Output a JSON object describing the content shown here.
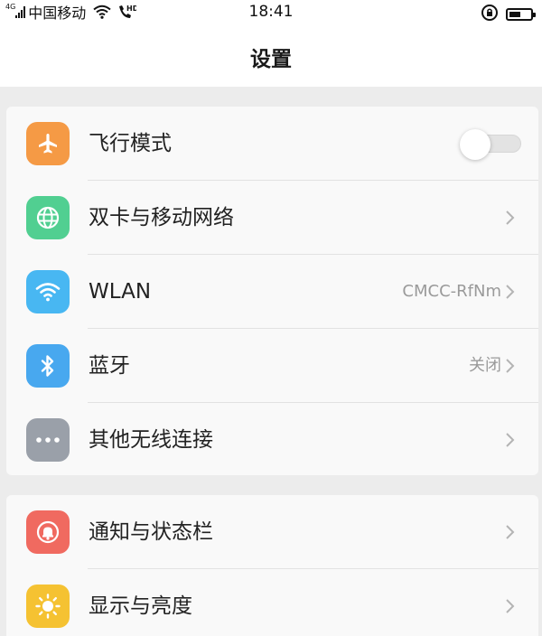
{
  "status_bar": {
    "network_type": "4G",
    "carrier": "中国移动",
    "time": "18:41",
    "battery_level": 0.55,
    "icons": [
      "signal-icon",
      "wifi-icon",
      "hd-call-icon",
      "rotation-lock-icon",
      "battery-icon"
    ]
  },
  "header": {
    "title": "设置"
  },
  "colors": {
    "airplane": "#f59a45",
    "network": "#51cf91",
    "wlan": "#48b7f2",
    "bluetooth": "#48a8ef",
    "other_wireless": "#9aa0a9",
    "notification": "#f06a60",
    "display": "#f5c232"
  },
  "group1": {
    "items": [
      {
        "label": "飞行模式",
        "icon": "airplane-icon",
        "control": "toggle",
        "toggle_on": false
      },
      {
        "label": "双卡与移动网络",
        "icon": "globe-icon",
        "value": ""
      },
      {
        "label": "WLAN",
        "icon": "wifi-icon",
        "value": "CMCC-RfNm"
      },
      {
        "label": "蓝牙",
        "icon": "bluetooth-icon",
        "value": "关闭"
      },
      {
        "label": "其他无线连接",
        "icon": "more-icon",
        "value": ""
      }
    ]
  },
  "group2": {
    "items": [
      {
        "label": "通知与状态栏",
        "icon": "bell-icon",
        "value": ""
      },
      {
        "label": "显示与亮度",
        "icon": "sun-icon",
        "value": ""
      }
    ]
  }
}
